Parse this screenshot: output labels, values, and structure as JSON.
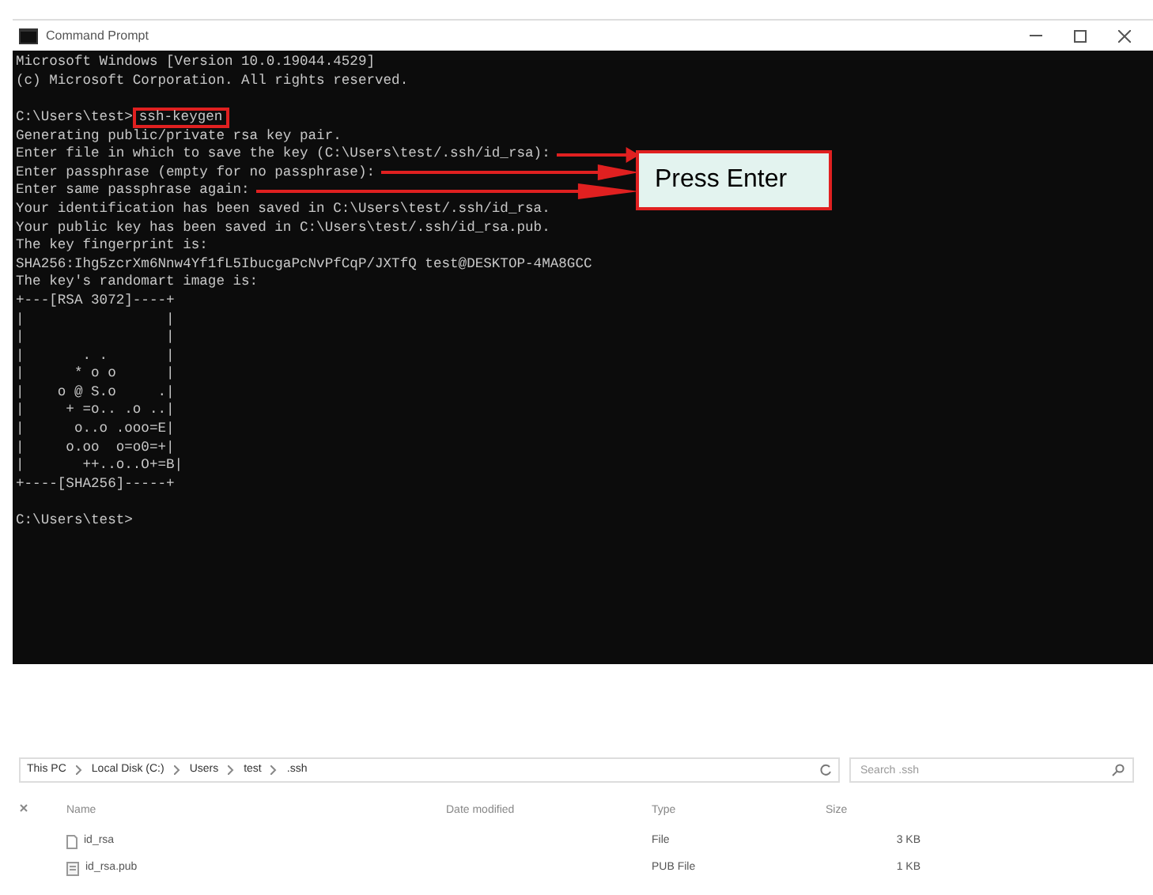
{
  "terminal": {
    "title": "Command Prompt",
    "lines": [
      {
        "kind": "text",
        "text": "Microsoft Windows [Version 10.0.19044.4529]"
      },
      {
        "kind": "text",
        "text": "(c) Microsoft Corporation. All rights reserved."
      },
      {
        "kind": "blank"
      },
      {
        "kind": "command",
        "prompt": "C:\\Users\\test>",
        "command": "ssh-keygen",
        "highlighted": true
      },
      {
        "kind": "text",
        "text": "Generating public/private rsa key pair."
      },
      {
        "kind": "text",
        "text": "Enter file in which to save the key (C:\\Users\\test/.ssh/id_rsa):",
        "arrow": true
      },
      {
        "kind": "text",
        "text": "Enter passphrase (empty for no passphrase):",
        "arrow": true
      },
      {
        "kind": "text",
        "text": "Enter same passphrase again:",
        "arrow": true
      },
      {
        "kind": "text",
        "text": "Your identification has been saved in C:\\Users\\test/.ssh/id_rsa."
      },
      {
        "kind": "text",
        "text": "Your public key has been saved in C:\\Users\\test/.ssh/id_rsa.pub."
      },
      {
        "kind": "text",
        "text": "The key fingerprint is:"
      },
      {
        "kind": "text",
        "text": "SHA256:Ihg5zcrXm6Nnw4Yf1fL5IbucgaPcNvPfCqP/JXTfQ test@DESKTOP-4MA8GCC"
      },
      {
        "kind": "text",
        "text": "The key's randomart image is:"
      },
      {
        "kind": "text",
        "text": "+---[RSA 3072]----+"
      },
      {
        "kind": "text",
        "text": "|                 |"
      },
      {
        "kind": "text",
        "text": "|                 |"
      },
      {
        "kind": "text",
        "text": "|       . .       |"
      },
      {
        "kind": "text",
        "text": "|      * o o      |"
      },
      {
        "kind": "text",
        "text": "|    o @ S.o     .|"
      },
      {
        "kind": "text",
        "text": "|     + =o.. .o ..|"
      },
      {
        "kind": "text",
        "text": "|      o..o .ooo=E|"
      },
      {
        "kind": "text",
        "text": "|     o.oo  o=o0=+|"
      },
      {
        "kind": "text",
        "text": "|       ++..o..O+=B|"
      },
      {
        "kind": "text",
        "text": "+----[SHA256]-----+"
      },
      {
        "kind": "blank"
      },
      {
        "kind": "command",
        "prompt": "C:\\Users\\test>"
      }
    ],
    "callout": "Press Enter"
  },
  "explorer": {
    "breadcrumb": [
      "This PC",
      "Local Disk (C:)",
      "Users",
      "test",
      ".ssh"
    ],
    "search": {
      "placeholder": "Search .ssh"
    },
    "columns": [
      "Name",
      "Date modified",
      "Type",
      "Size"
    ],
    "rows": [
      {
        "name": "id_rsa",
        "type": "File",
        "size": "3 KB",
        "kind": "file"
      },
      {
        "name": "id_rsa.pub",
        "type": "PUB File",
        "size": "1 KB",
        "kind": "pub"
      }
    ]
  }
}
